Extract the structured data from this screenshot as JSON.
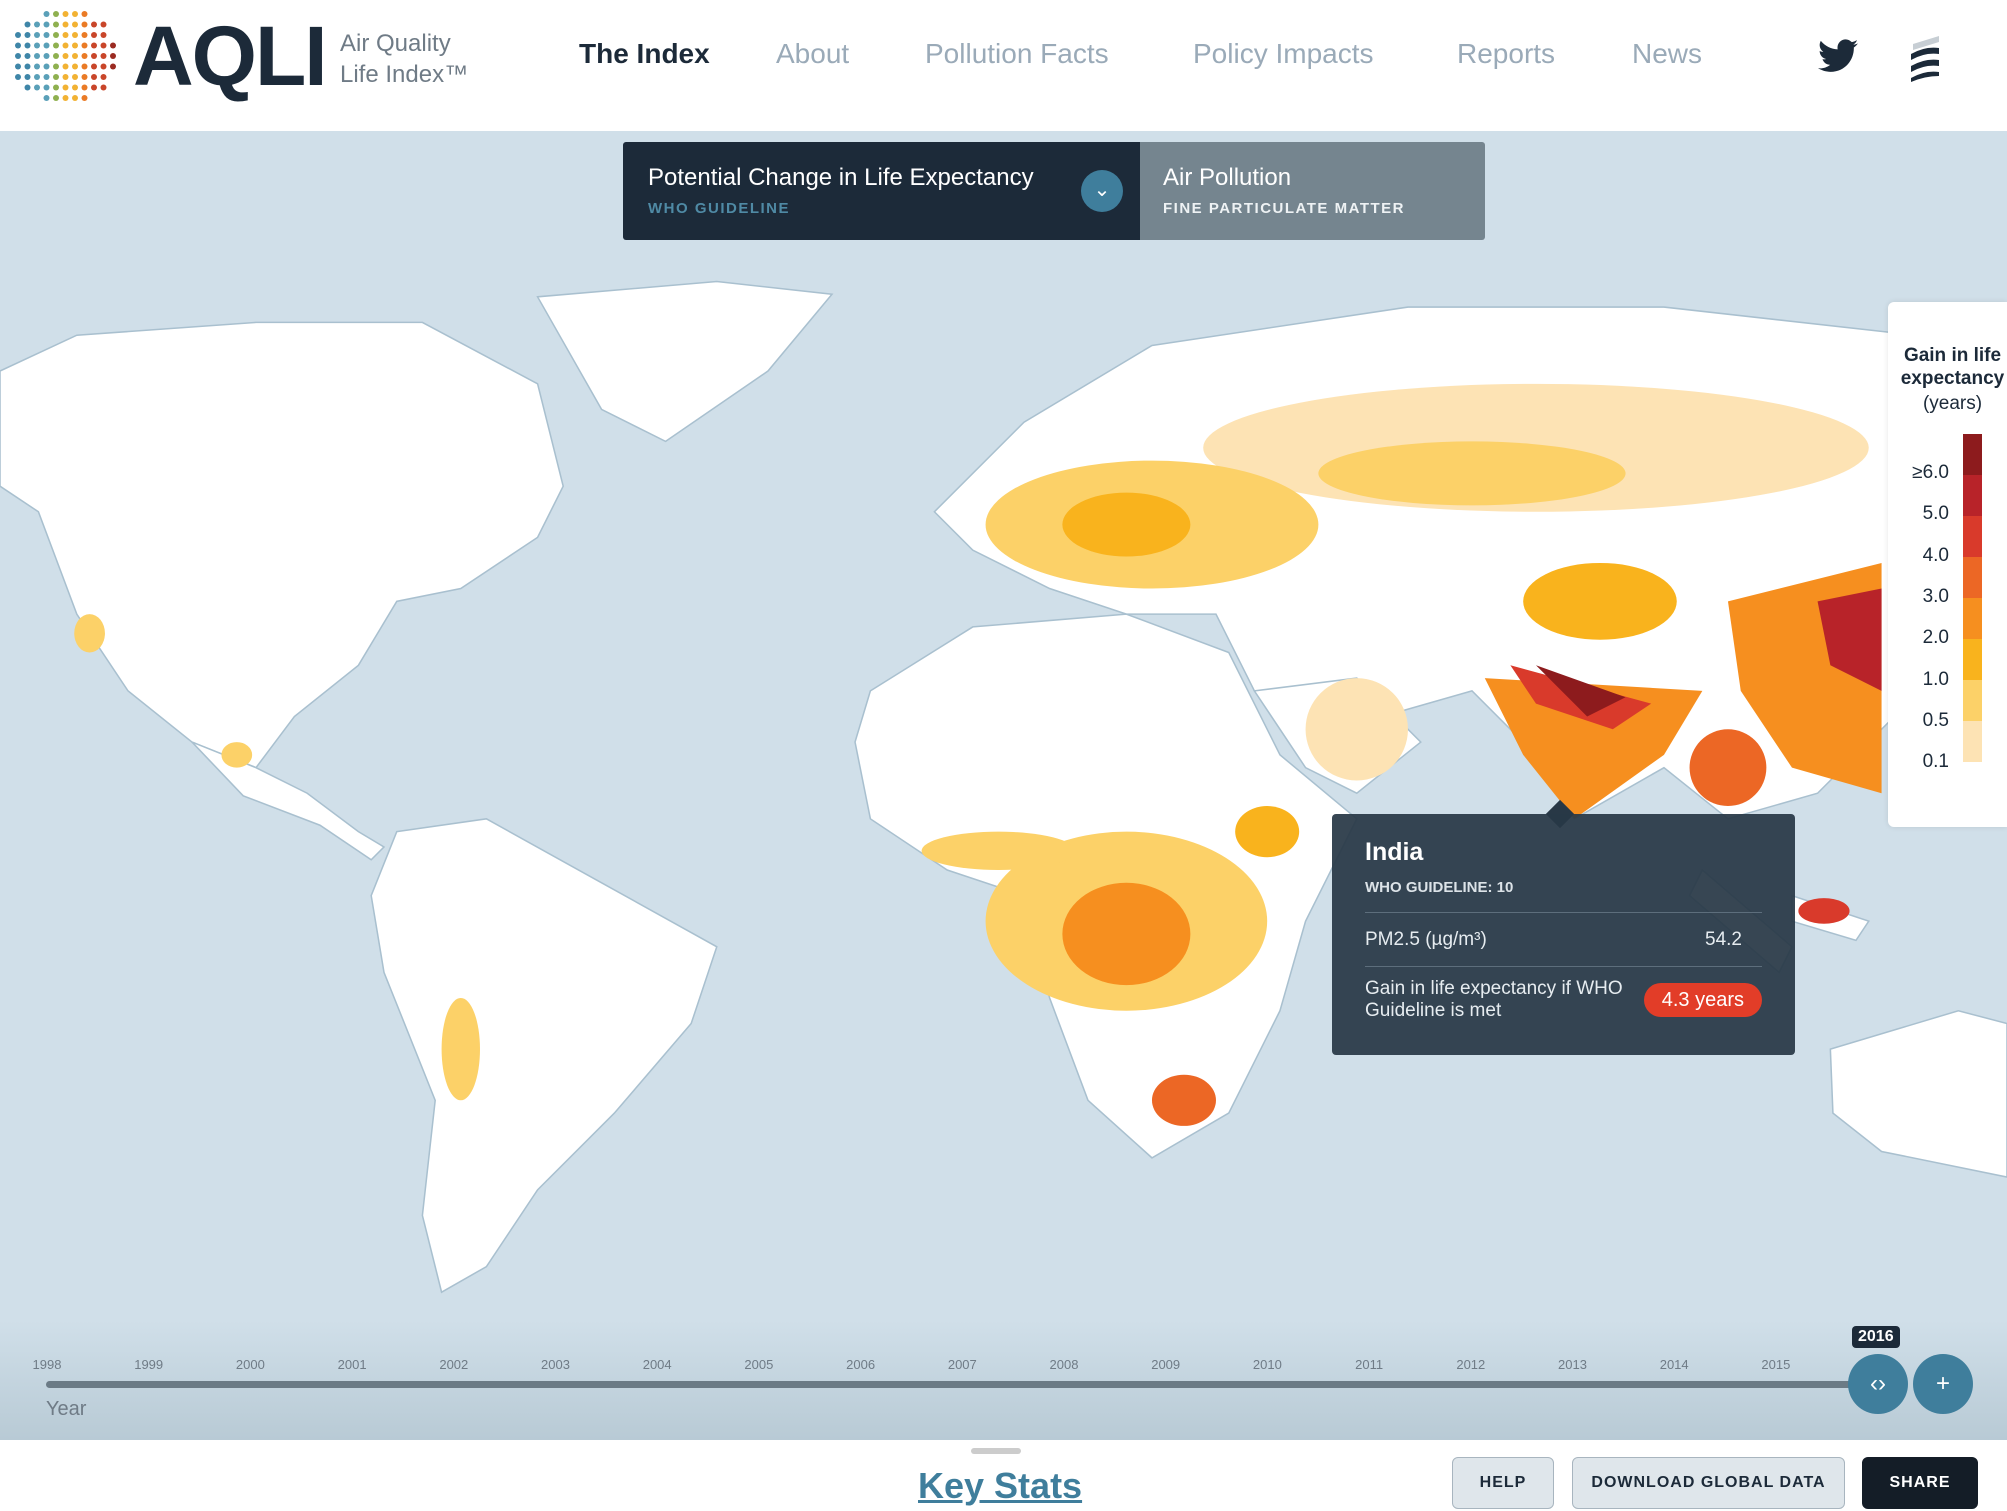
{
  "header": {
    "logo": {
      "text": "AQLI",
      "subtitle_line1": "Air Quality",
      "subtitle_line2": "Life Index™"
    },
    "nav": [
      {
        "label": "The Index",
        "active": true
      },
      {
        "label": "About"
      },
      {
        "label": "Pollution Facts"
      },
      {
        "label": "Policy Impacts"
      },
      {
        "label": "Reports"
      },
      {
        "label": "News"
      }
    ],
    "icons": [
      "twitter-icon",
      "menu-icon"
    ]
  },
  "selector": {
    "left": {
      "title": "Potential Change in Life Expectancy",
      "subtitle": "WHO GUIDELINE",
      "chevron": "⌄"
    },
    "right": {
      "title": "Air Pollution",
      "subtitle": "FINE PARTICULATE MATTER"
    }
  },
  "legend": {
    "title": "Gain in life expectancy",
    "unit": "(years)",
    "labels": [
      "≥6.0",
      "5.0",
      "4.0",
      "3.0",
      "2.0",
      "1.0",
      "0.5",
      "0.1"
    ],
    "colors": [
      "#8d1b1d",
      "#b82329",
      "#d93a2b",
      "#ec6725",
      "#f68f1f",
      "#f9b31d",
      "#fcd168",
      "#fde3b4",
      "#ffffff"
    ]
  },
  "tooltip": {
    "country": "India",
    "guideline": "WHO GUIDELINE: 10",
    "pm_label": "PM2.5 (µg/m³)",
    "pm_value": "54.2",
    "gain_label": "Gain in life expectancy if WHO Guideline is met",
    "gain_value": "4.3 years"
  },
  "timeline": {
    "years": [
      "1998",
      "1999",
      "2000",
      "2001",
      "2002",
      "2003",
      "2004",
      "2005",
      "2006",
      "2007",
      "2008",
      "2009",
      "2010",
      "2011",
      "2012",
      "2013",
      "2014",
      "2015"
    ],
    "label": "Year",
    "current": "2016",
    "thumb": "‹›",
    "plus": "+"
  },
  "footer": {
    "key_stats": "Key Stats",
    "help": "HELP",
    "download": "DOWNLOAD GLOBAL DATA",
    "share": "SHARE"
  },
  "colors": {
    "ocean": "#d0dfe9",
    "navy": "#1c2a39",
    "accent": "#3f7e9c",
    "badge": "#e23d28"
  }
}
